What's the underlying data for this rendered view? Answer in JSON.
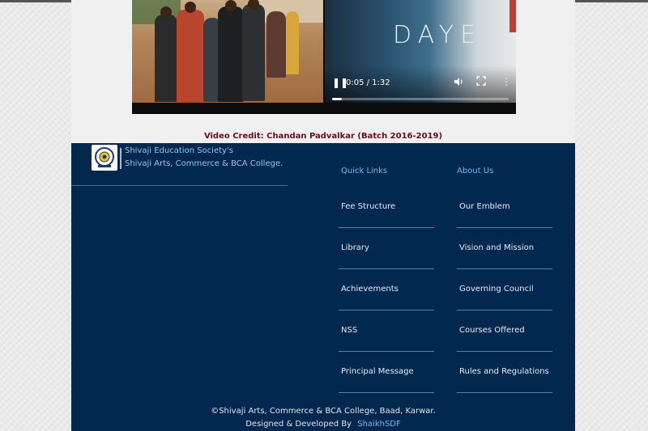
{
  "video": {
    "overlay_title": "DAYE",
    "time_display": "0:05 / 1:32",
    "progress_fraction": 0.054,
    "icons": {
      "play_pause": "pause-icon",
      "volume": "volume-icon",
      "fullscreen": "fullscreen-icon",
      "more": "more-icon"
    }
  },
  "credit": "Video Credit: Chandan Padvalkar (Batch 2016-2019)",
  "brand": {
    "line1": "Shivaji Education Society's",
    "line2": "Shivaji Arts, Commerce & BCA College."
  },
  "quick_links": {
    "heading": "Quick Links",
    "items": [
      "Fee Structure",
      "Library",
      "Achievements",
      "NSS",
      "Principal Message"
    ]
  },
  "about_us": {
    "heading": "About Us",
    "items": [
      "Our Emblem",
      "Vision and Mission",
      "Governing Council",
      "Courses Offered",
      "Rules and Regulations"
    ]
  },
  "footer": {
    "copyright": "©Shivaji Arts, Commerce & BCA College, Baad, Karwar.",
    "designed_prefix": "Designed & Developed By",
    "designer": "ShaikhSDF"
  },
  "colors": {
    "footer_bg": "#02284f",
    "credit_text": "#6b0a23",
    "link_accent": "#6fb9f0"
  }
}
